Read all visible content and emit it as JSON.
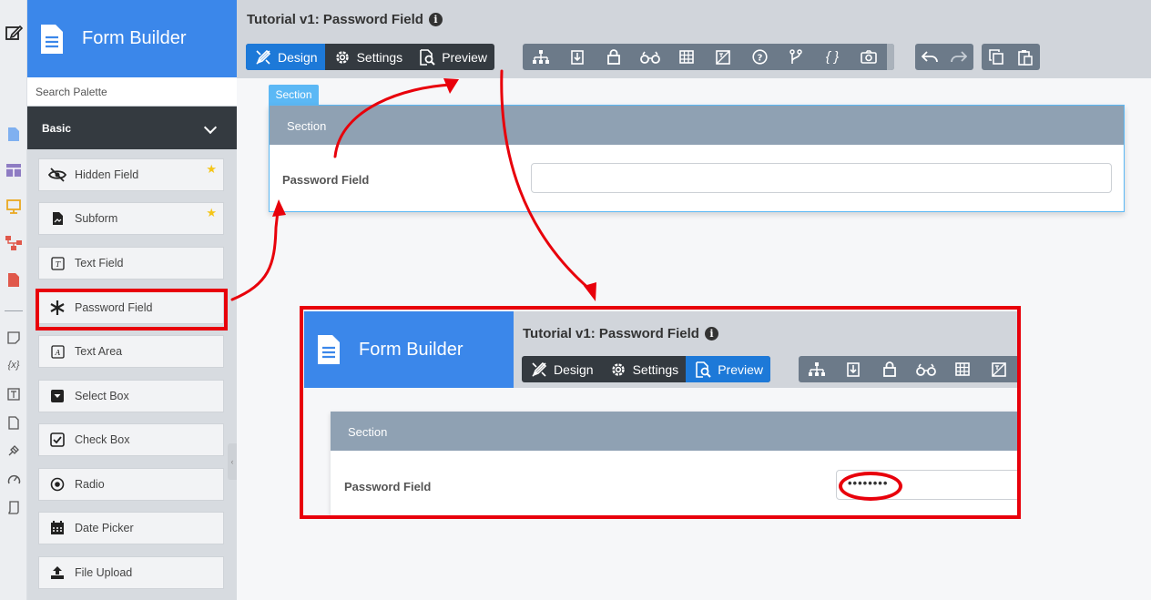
{
  "app": {
    "title": "Form Builder"
  },
  "form": {
    "title": "Tutorial v1: Password Field",
    "info_icon": "i"
  },
  "modes": [
    {
      "label": "Design",
      "icon": "design-icon"
    },
    {
      "label": "Settings",
      "icon": "gear-icon"
    },
    {
      "label": "Preview",
      "icon": "preview-icon"
    }
  ],
  "palette": {
    "search_placeholder": "Search Palette",
    "category": "Basic",
    "items": [
      {
        "label": "Hidden Field",
        "icon": "eye-slash-icon",
        "starred": true
      },
      {
        "label": "Subform",
        "icon": "subform-icon",
        "starred": true
      },
      {
        "label": "Text Field",
        "icon": "text-field-icon"
      },
      {
        "label": "Password Field",
        "icon": "asterisk-icon"
      },
      {
        "label": "Text Area",
        "icon": "text-area-icon"
      },
      {
        "label": "Select Box",
        "icon": "select-box-icon"
      },
      {
        "label": "Check Box",
        "icon": "check-box-icon"
      },
      {
        "label": "Radio",
        "icon": "radio-icon"
      },
      {
        "label": "Date Picker",
        "icon": "calendar-icon"
      },
      {
        "label": "File Upload",
        "icon": "upload-icon"
      }
    ]
  },
  "canvas": {
    "section_tab": "Section",
    "section_header": "Section",
    "field_label": "Password Field"
  },
  "preview": {
    "section_header": "Section",
    "field_label": "Password Field",
    "password_value": "••••••••"
  },
  "colors": {
    "brand": "#3b87ea",
    "active_mode": "#1d79d8",
    "annotation": "#e8000b",
    "section_header": "#8fa1b3"
  }
}
